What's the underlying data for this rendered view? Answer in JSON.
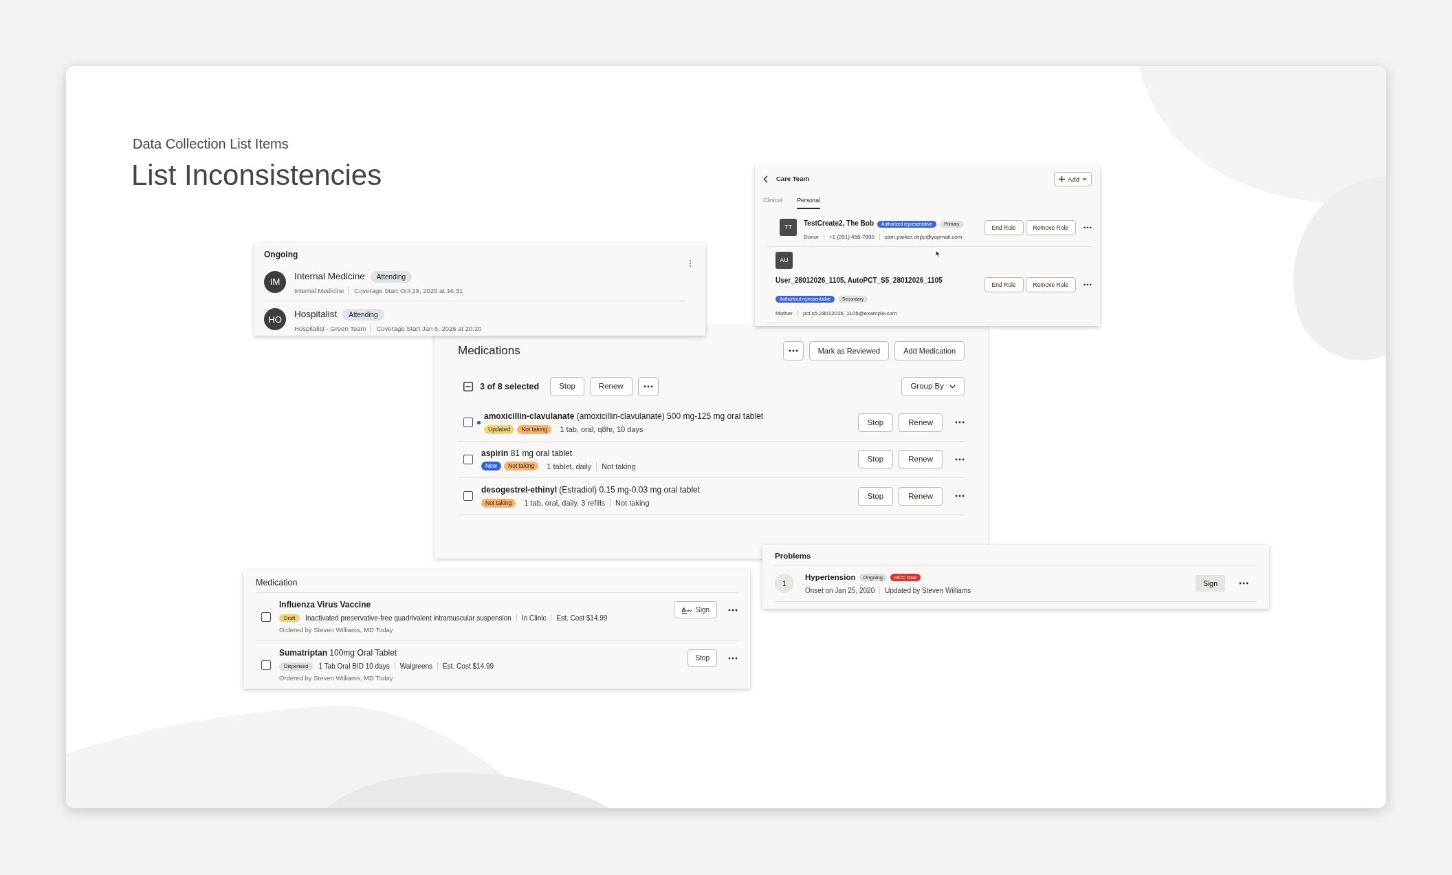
{
  "slide": {
    "eyebrow": "Data Collection List Items",
    "title": "List Inconsistencies"
  },
  "ongoing": {
    "title": "Ongoing",
    "items": [
      {
        "initials": "IM",
        "name": "Internal Medicine",
        "badge": "Attending",
        "details": [
          "Internal Medicine",
          "Coverage Start Oct 29, 2025 at 16:31"
        ]
      },
      {
        "initials": "HO",
        "name": "Hospitalist",
        "badge": "Attending",
        "details": [
          "Hospitalist - Green Team",
          "Coverage Start Jan 6, 2026 at 20:20"
        ]
      }
    ]
  },
  "care_team": {
    "title": "Care Team",
    "add_button": "Add",
    "tabs": [
      {
        "label": "Clinical",
        "selected": false
      },
      {
        "label": "Personal",
        "selected": true
      }
    ],
    "members": [
      {
        "kind": "inline",
        "initials": "TT",
        "name": "TestCreate2, The Bob",
        "tags": [
          {
            "label": "Authorized representative",
            "color": "#3d66d8"
          },
          {
            "label": "Primary",
            "color": "#e2e0dd"
          }
        ],
        "details": [
          "Donor",
          "+1 (201) 456-7890",
          "sam.parker.ohpp@yopmail.com"
        ],
        "buttons": [
          "End Role",
          "Remove Role"
        ]
      },
      {
        "kind": "stacked",
        "initials": "AU",
        "name": "User_28012026_1105, AutoPCT_S5_28012026_1105",
        "tags": [
          {
            "label": "Authorized representative",
            "color": "#3d66d8"
          },
          {
            "label": "Secondary",
            "color": "#e2e0dd"
          }
        ],
        "details": [
          "Mother",
          "pct.s5.28012026_1105@example.com"
        ],
        "buttons": [
          "End Role",
          "Remove Role"
        ]
      }
    ]
  },
  "medications": {
    "title": "Medications",
    "header_buttons": [
      "Mark as Reviewed",
      "Add Medication"
    ],
    "selection": {
      "indeterminate": true,
      "label": "3 of 8 selected",
      "buttons": [
        "Stop",
        "Renew"
      ]
    },
    "group_by": "Group By",
    "rows": [
      {
        "checked": false,
        "unread": true,
        "title": "**amoxicillin-clavulanate** (amoxicillin-clavulanate) 500 mg-125 mg oral tablet",
        "tags": [
          {
            "label": "Updated",
            "color": "#f3d27c"
          },
          {
            "label": "Not taking",
            "color": "#f7b36e"
          }
        ],
        "details": [
          "1 tab, oral, q8hr, 10 days"
        ],
        "buttons": [
          "Stop",
          "Renew"
        ]
      },
      {
        "checked": false,
        "unread": false,
        "title": "**aspirin** 81 mg oral tablet",
        "tags": [
          {
            "label": "New",
            "color": "#2f63d6"
          },
          {
            "label": "Not taking",
            "color": "#f7b36e"
          }
        ],
        "details": [
          "1 tablet, daily",
          "Not taking"
        ],
        "buttons": [
          "Stop",
          "Renew"
        ]
      },
      {
        "checked": false,
        "unread": false,
        "title": "**desogestrel-ethinyl** (Estradiol) 0.15 mg-0.03 mg oral tablet",
        "tags": [
          {
            "label": "Not taking",
            "color": "#f7b36e"
          }
        ],
        "details": [
          "1 tab, oral, daily, 3 refills",
          "Not taking"
        ],
        "buttons": [
          "Stop",
          "Renew"
        ]
      }
    ]
  },
  "medication_orders": {
    "title": "Medication",
    "rows": [
      {
        "checked": false,
        "bold": true,
        "title": "Influenza Virus Vaccine",
        "tags": [
          {
            "label": "Draft",
            "color": "#f1cf72"
          }
        ],
        "details": [
          "Inactivated preservative-free quadrivalent intramuscular suspension",
          "In Clinic",
          "Est. Cost $14.99"
        ],
        "ordered": "Ordered by Steven Williams, MD Today",
        "action": {
          "label": "Sign",
          "has_icon": true
        }
      },
      {
        "checked": false,
        "bold": false,
        "title": "**Sumatriptan** 100mg Oral Tablet",
        "tags": [
          {
            "label": "Dispensed",
            "color": "#dfdddb"
          }
        ],
        "details": [
          "1 Tab Oral BID 10 days",
          "Walgreens",
          "Est. Cost $14.99"
        ],
        "ordered": "Ordered by Steven Williams, MD Today",
        "action": {
          "label": "Stop",
          "has_icon": false
        }
      }
    ]
  },
  "problems": {
    "title": "Problems",
    "items": [
      {
        "number": "1",
        "name": "Hypertension",
        "tags": [
          {
            "label": "Ongoing",
            "color": "#dfdddb"
          },
          {
            "label": "HCC Due",
            "color": "#d1372f"
          }
        ],
        "details": [
          "Onset on Jan 25, 2020",
          "Updated by Steven Williams"
        ],
        "button": "Sign"
      }
    ]
  }
}
